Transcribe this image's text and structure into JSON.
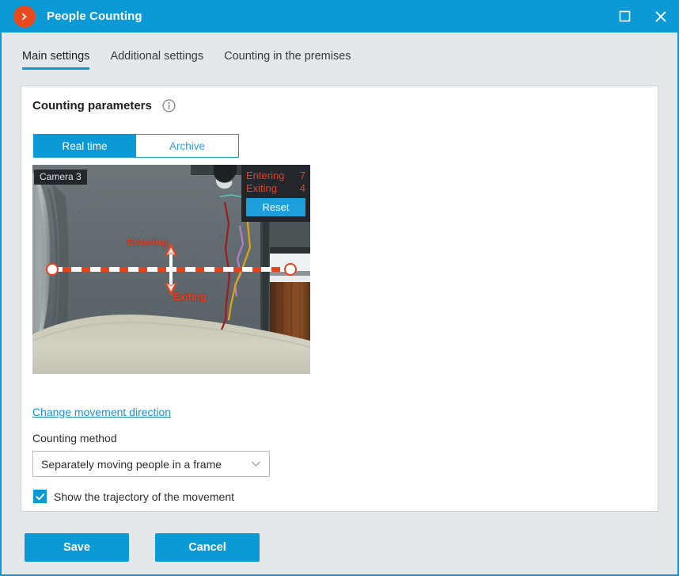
{
  "window": {
    "title": "People Counting",
    "logo_icon": "chevron-right-circle-icon",
    "maximize_icon": "maximize-icon",
    "close_icon": "close-icon",
    "accent_color": "#0c9ad6",
    "logo_color": "#e8491f"
  },
  "tabs": [
    {
      "label": "Main settings",
      "active": true
    },
    {
      "label": "Additional settings",
      "active": false
    },
    {
      "label": "Counting in the premises",
      "active": false
    }
  ],
  "card": {
    "title": "Counting parameters",
    "info_icon": "info-circle-icon"
  },
  "mode_toggle": {
    "options": [
      {
        "label": "Real time",
        "active": true
      },
      {
        "label": "Archive",
        "active": false
      }
    ]
  },
  "video": {
    "camera_label": "Camera 3",
    "counter": {
      "entering_label": "Entering",
      "entering_value": "7",
      "exiting_label": "Exiting",
      "exiting_value": "4",
      "reset_label": "Reset"
    },
    "zone_labels": {
      "entering": "Entering",
      "exiting": "Exiting"
    },
    "line_color": "#e8421f",
    "label_color": "#ef3b1e"
  },
  "form": {
    "change_direction_link": "Change movement direction",
    "counting_method_label": "Counting method",
    "counting_method_value": "Separately moving people in a frame",
    "counting_method_chevron": "chevron-down-icon",
    "show_trajectory_label": "Show the trajectory of the movement",
    "show_trajectory_checked": true
  },
  "footer": {
    "save_label": "Save",
    "cancel_label": "Cancel"
  }
}
